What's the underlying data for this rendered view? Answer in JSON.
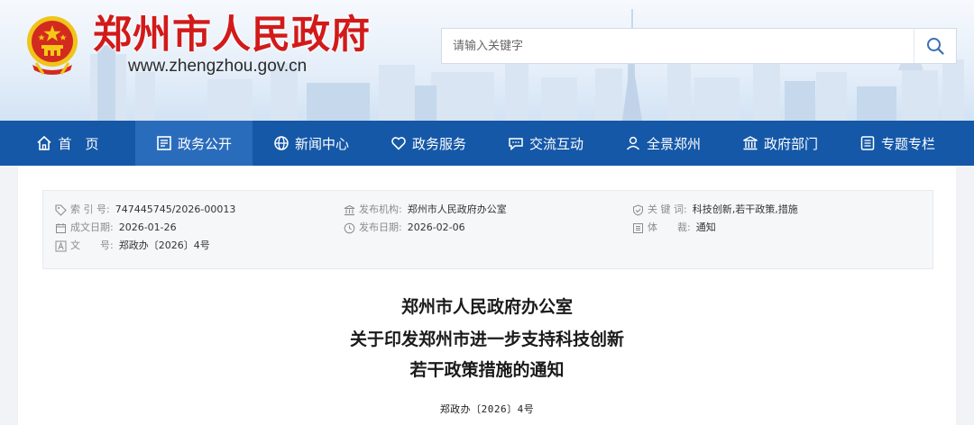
{
  "header": {
    "site_title": "郑州市人民政府",
    "site_url": "www.zhengzhou.gov.cn",
    "search": {
      "placeholder": "请输入关键字"
    }
  },
  "nav": {
    "items": [
      {
        "label": "首　页",
        "icon": "home-icon"
      },
      {
        "label": "政务公开",
        "icon": "document-icon",
        "active": true
      },
      {
        "label": "新闻中心",
        "icon": "globe-icon"
      },
      {
        "label": "政务服务",
        "icon": "heart-icon"
      },
      {
        "label": "交流互动",
        "icon": "chat-icon"
      },
      {
        "label": "全景郑州",
        "icon": "user-location-icon"
      },
      {
        "label": "政府部门",
        "icon": "building-icon"
      },
      {
        "label": "专题专栏",
        "icon": "topic-icon"
      }
    ]
  },
  "meta": {
    "index_no": {
      "label": "索 引 号:",
      "value": "747445745/2026-00013"
    },
    "publisher": {
      "label": "发布机构:",
      "value": "郑州市人民政府办公室"
    },
    "keywords": {
      "label": "关 键 词:",
      "value": "科技创新,若干政策,措施"
    },
    "created_date": {
      "label": "成文日期:",
      "value": "2026-01-26"
    },
    "publish_date": {
      "label": "发布日期:",
      "value": "2026-02-06"
    },
    "genre": {
      "label": "体　　裁:",
      "value": "通知"
    },
    "doc_no": {
      "label": "文　　号:",
      "value": "郑政办〔2026〕4号"
    }
  },
  "document": {
    "title_lines": [
      "郑州市人民政府办公室",
      "关于印发郑州市进一步支持科技创新",
      "若干政策措施的通知"
    ],
    "number": "郑政办〔2026〕4号"
  },
  "colors": {
    "brand_red": "#d21a1a",
    "nav_blue": "#1558a8",
    "nav_active": "#2a6cbc",
    "search_icon": "#3a6fb5"
  }
}
